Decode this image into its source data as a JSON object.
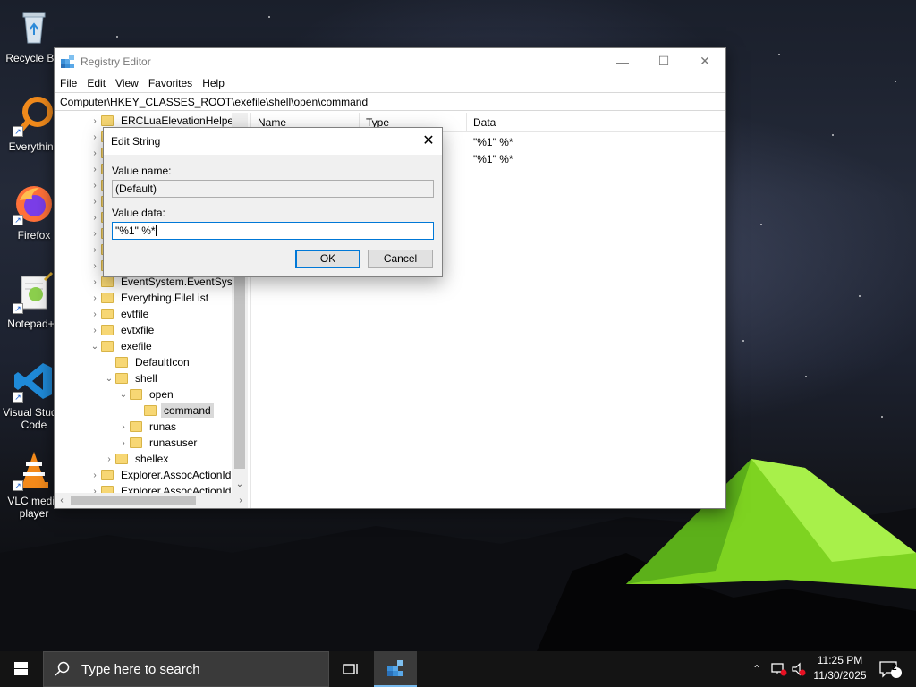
{
  "desktop": {
    "icons": [
      {
        "label": "Recycle Bin",
        "icon": "recycle-bin-icon"
      },
      {
        "label": "Everything",
        "icon": "everything-search-icon"
      },
      {
        "label": "Firefox",
        "icon": "firefox-icon"
      },
      {
        "label": "Notepad++",
        "icon": "notepad-plus-plus-icon"
      },
      {
        "label": "Visual Studio Code",
        "icon": "vscode-icon"
      },
      {
        "label": "VLC media player",
        "icon": "vlc-icon"
      }
    ]
  },
  "regedit": {
    "title": "Registry Editor",
    "menu": [
      "File",
      "Edit",
      "View",
      "Favorites",
      "Help"
    ],
    "address": "Computer\\HKEY_CLASSES_ROOT\\exefile\\shell\\open\\command",
    "tree": [
      {
        "label": "ERCLuaElevationHelper",
        "arrow": "›",
        "indent": 0,
        "selected": false
      },
      {
        "label": "",
        "arrow": "›",
        "indent": 0,
        "selected": false
      },
      {
        "label": "",
        "arrow": "›",
        "indent": 0,
        "selected": false
      },
      {
        "label": "",
        "arrow": "›",
        "indent": 0,
        "selected": false
      },
      {
        "label": "",
        "arrow": "›",
        "indent": 0,
        "selected": false
      },
      {
        "label": "",
        "arrow": "›",
        "indent": 0,
        "selected": false
      },
      {
        "label": "",
        "arrow": "›",
        "indent": 0,
        "selected": false
      },
      {
        "label": "",
        "arrow": "›",
        "indent": 0,
        "selected": false
      },
      {
        "label": "",
        "arrow": "›",
        "indent": 0,
        "selected": false
      },
      {
        "label": "",
        "arrow": "›",
        "indent": 0,
        "selected": false
      },
      {
        "label": "EventSystem.EventSyste",
        "arrow": "›",
        "indent": 0,
        "selected": false
      },
      {
        "label": "Everything.FileList",
        "arrow": "›",
        "indent": 0,
        "selected": false
      },
      {
        "label": "evtfile",
        "arrow": "›",
        "indent": 0,
        "selected": false
      },
      {
        "label": "evtxfile",
        "arrow": "›",
        "indent": 0,
        "selected": false
      },
      {
        "label": "exefile",
        "arrow": "⌄",
        "indent": 0,
        "selected": false
      },
      {
        "label": "DefaultIcon",
        "arrow": "",
        "indent": 1,
        "selected": false
      },
      {
        "label": "shell",
        "arrow": "⌄",
        "indent": 1,
        "selected": false
      },
      {
        "label": "open",
        "arrow": "⌄",
        "indent": 2,
        "selected": false
      },
      {
        "label": "command",
        "arrow": "",
        "indent": 3,
        "selected": true
      },
      {
        "label": "runas",
        "arrow": "›",
        "indent": 2,
        "selected": false
      },
      {
        "label": "runasuser",
        "arrow": "›",
        "indent": 2,
        "selected": false
      },
      {
        "label": "shellex",
        "arrow": "›",
        "indent": 1,
        "selected": false
      },
      {
        "label": "Explorer.AssocActionId",
        "arrow": "›",
        "indent": 0,
        "selected": false
      },
      {
        "label": "Explorer.AssocActionId",
        "arrow": "›",
        "indent": 0,
        "selected": false
      }
    ],
    "columns": [
      "Name",
      "Type",
      "Data"
    ],
    "rows": [
      {
        "data": "\"%1\" %*"
      },
      {
        "data": "\"%1\" %*"
      }
    ]
  },
  "dialog": {
    "title": "Edit String",
    "value_name_label": "Value name:",
    "value_name": "(Default)",
    "value_data_label": "Value data:",
    "value_data": "\"%1\" %*",
    "ok_label": "OK",
    "cancel_label": "Cancel"
  },
  "taskbar": {
    "search_placeholder": "Type here to search",
    "time": "11:25 PM",
    "date": "11/30/2025",
    "notification_count": "2"
  }
}
